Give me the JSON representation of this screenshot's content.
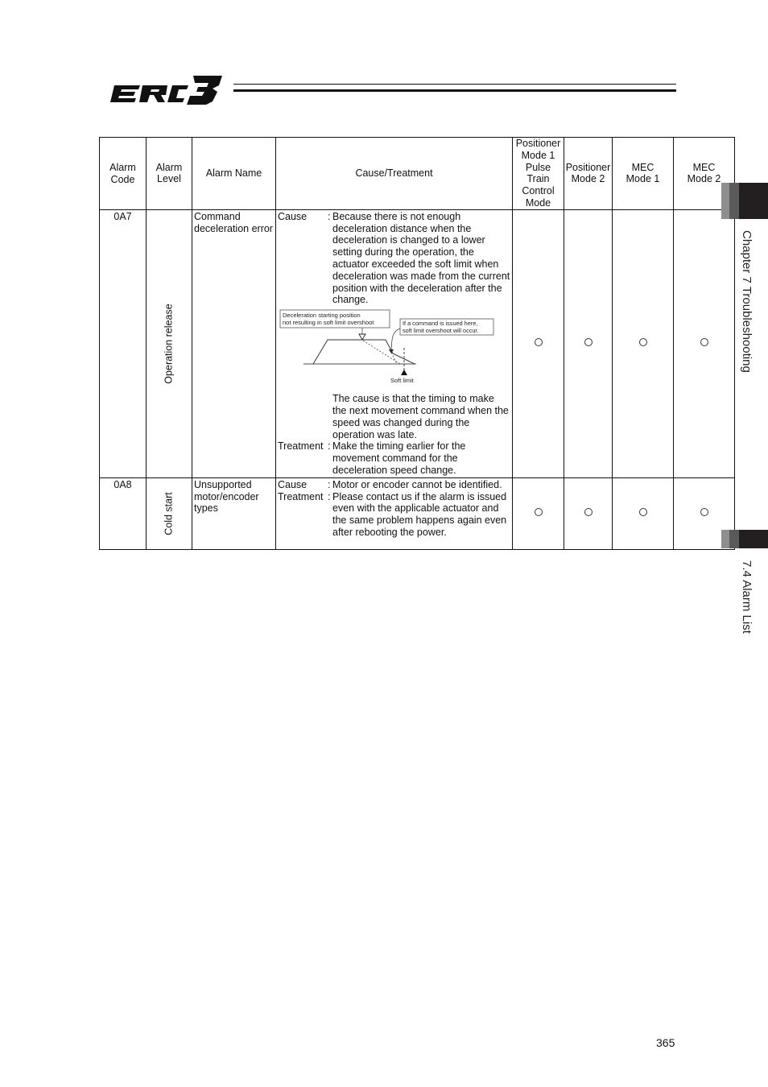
{
  "header": {
    "logo_text": "ERC3"
  },
  "table": {
    "columns": {
      "alarm_code": "Alarm Code",
      "alarm_level": "Alarm Level",
      "alarm_name": "Alarm Name",
      "cause_treatment": "Cause/Treatment",
      "mode_pos1": "Positioner Mode 1 Pulse Train Control Mode",
      "mode_pos2": "Positioner Mode 2",
      "mode_mec1": "MEC Mode 1",
      "mode_mec2": "MEC Mode 2"
    },
    "labels": {
      "cause": "Cause",
      "treatment": "Treatment",
      "colon": ":"
    },
    "rows": [
      {
        "code": "0A7",
        "level": "Operation release",
        "name": "Command deceleration error",
        "cause": "Because there is not enough deceleration distance when the deceleration is changed to a lower setting during the operation, the actuator exceeded the soft limit when deceleration was made from the current position with the deceleration after the change.",
        "diagram": {
          "label_start_line1": "Deceleration starting position",
          "label_start_line2": "not resulting in soft limit overshoot",
          "label_cmd_line1": "If a command is issued here,",
          "label_cmd_line2": "soft limit overshoot will occur.",
          "label_soft_limit": "Soft limit"
        },
        "cause_extra": "The cause is that the timing to make the next movement command when the speed was changed during the operation was late.",
        "treatment": "Make the timing earlier for the movement command for the deceleration speed change.",
        "modes": [
          "○",
          "○",
          "○",
          "○"
        ]
      },
      {
        "code": "0A8",
        "level": "Cold start",
        "name": "Unsupported motor/encoder types",
        "cause": "Motor or encoder cannot be identified.",
        "treatment": "Please contact us if the alarm is issued even with the applicable actuator and the same problem happens again even after rebooting the power.",
        "modes": [
          "○",
          "○",
          "○",
          "○"
        ]
      }
    ]
  },
  "side_tabs": {
    "chapter": "Chapter 7 Troubleshooting",
    "section": "7.4 Alarm List"
  },
  "footer": {
    "page_number": "365"
  }
}
